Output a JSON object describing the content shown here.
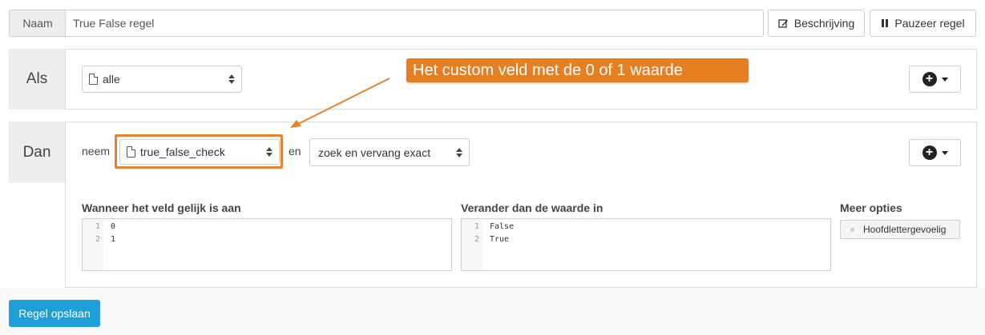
{
  "header": {
    "name_label": "Naam",
    "name_value": "True False regel",
    "description_button": "Beschrijving",
    "pause_button": "Pauzeer regel"
  },
  "if_section": {
    "label": "Als",
    "source_select": "alle"
  },
  "then_section": {
    "label": "Dan",
    "take_word": "neem",
    "field_select": "true_false_check",
    "and_word": "en",
    "action_select": "zoek en vervang exact"
  },
  "callout": {
    "text": "Het custom veld met de 0 of 1 waarde",
    "color": "#e67e22"
  },
  "replace": {
    "when_title": "Wanneer het veld gelijk is aan",
    "when_lines": [
      {
        "num": "1",
        "text": "0"
      },
      {
        "num": "2",
        "text": "1"
      }
    ],
    "change_title": "Verander dan de waarde in",
    "change_lines": [
      {
        "num": "1",
        "text": "False"
      },
      {
        "num": "2",
        "text": "True"
      }
    ],
    "more_title": "Meer opties",
    "case_option": "Hoofdlettergevoelig"
  },
  "footer": {
    "save_button": "Regel opslaan",
    "save_color": "#1e9fd8"
  },
  "icons": {
    "edit": "edit-icon",
    "pause": "pause-icon",
    "file": "file-icon",
    "plus": "plus-circle-icon",
    "caret": "chevron-down-icon"
  }
}
